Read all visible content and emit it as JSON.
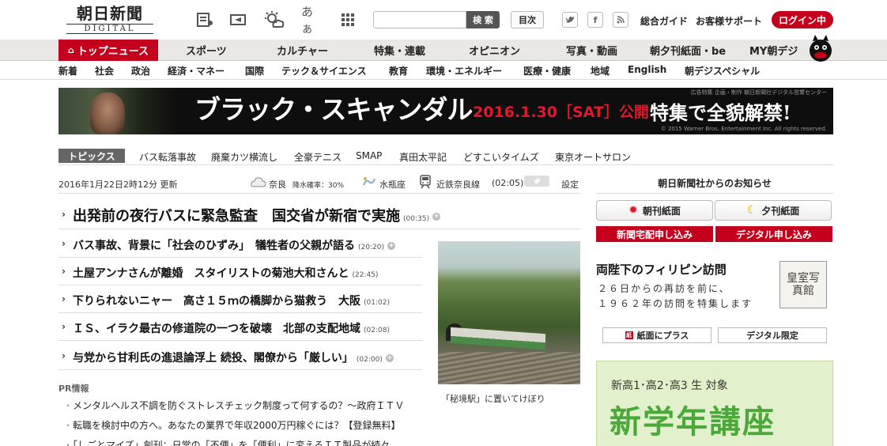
{
  "header": {
    "logo_jp": "朝日新聞",
    "logo_en": "DIGITAL",
    "font_label": "あぁ",
    "search_placeholder": "",
    "search_button": "検 索",
    "mokuji": "目次",
    "sns": {
      "twitter": "t",
      "facebook": "f",
      "rss": "rss"
    },
    "guide": "総合ガイド",
    "support": "お客様サポート",
    "login": "ログイン中"
  },
  "main_nav": [
    "トップニュース",
    "スポーツ",
    "カルチャー",
    "特集・連載",
    "オピニオン",
    "写真・動画",
    "朝夕刊紙面・be",
    "MY朝デジ"
  ],
  "sub_nav": [
    "新着",
    "社会",
    "政治",
    "経済・マネー",
    "国際",
    "テック＆サイエンス",
    "教育",
    "環境・エネルギー",
    "医療・健康",
    "地域",
    "English",
    "朝デジスペシャル"
  ],
  "banner": {
    "title": "ブラック・スキャンダル",
    "date": "2016.1.30［SAT］公開",
    "tokushu": "特集で全貌解禁!",
    "pr_note": "広告特集 企画・制作 朝日新聞社デジタル営業センター",
    "credit": "© 2015 Warner Bros. Entertainment Inc. All rights reserved."
  },
  "topics": {
    "label": "トピックス",
    "items": [
      "バス転落事故",
      "廃棄カツ横流し",
      "全豪テニス",
      "SMAP",
      "真田太平記",
      "どすこいタイムズ",
      "東京オートサロン"
    ]
  },
  "info": {
    "updated": "2016年1月22日2時12分 更新",
    "weather_city": "奈良",
    "rain_label": "降水確率：30%",
    "constellation": "水瓶座",
    "train": "近鉄奈良線",
    "train_time": "(02:05)",
    "settings": "設定"
  },
  "top_headline": {
    "text": "出発前の夜行バスに緊急監査　国交省が新宿で実施",
    "time": "(00:35)"
  },
  "headlines": [
    {
      "text": "バス事故、背景に「社会のひずみ」　犠牲者の父親が語る",
      "time": "(20:20)"
    },
    {
      "text": "土屋アンナさんが離婚　スタイリストの菊池大和さんと",
      "time": "(22:45)"
    },
    {
      "text": "下りられないニャー　高さ１５ｍの橋脚から猫救う　大阪",
      "time": "(01:02)"
    },
    {
      "text": "ＩＳ、イラク最古の修道院の一つを破壊　北部の支配地域",
      "time": "(02:08)"
    },
    {
      "text": "与党から甘利氏の進退論浮上 続投、閣僚から「厳しい」",
      "time": "(02:00)"
    }
  ],
  "photo_caption": "「秘境駅」に置いてけぼり",
  "pr": {
    "label": "PR情報",
    "items": [
      "メンタルヘルス不調を防ぐストレスチェック制度って何するの？～政府ＩＴＶ",
      "転職を検討中の方へ。あなたの業界で年収2000万円稼ぐには？【登録無料】",
      "「しごとマイズ」創刊：日常の「不便」を「便利」に変えるＩＴ製品が続々"
    ]
  },
  "right": {
    "notice_title": "朝日新聞社からのお知らせ",
    "morning": "朝刊紙面",
    "evening": "夕刊紙面",
    "delivery": "新聞宅配申し込み",
    "digital_apply": "デジタル申し込み",
    "feature_title": "両陛下のフィリピン訪問",
    "feature_desc": [
      "２６日からの再訪を前に、",
      "１９６２年の訪問を特集します"
    ],
    "stamp": "皇室写真館",
    "plus_button": "紙面にプラス",
    "digital_limited": "デジタル限定",
    "ad_sub": "新高1･高2･高3 生 対象",
    "ad_big": "新学年講座"
  },
  "colors": {
    "accent": "#c4001c",
    "nav_bg": "#e9e8e6",
    "ad_green": "#4ba83a"
  }
}
